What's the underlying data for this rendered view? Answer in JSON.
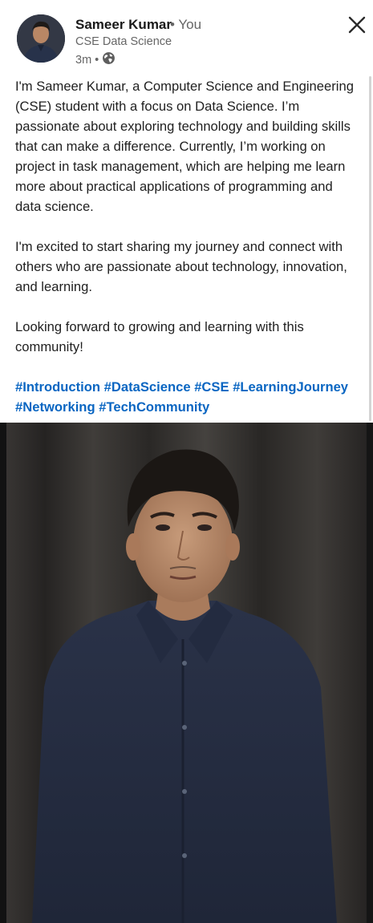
{
  "author": {
    "name": "Sameer Kumar",
    "degree": "• You",
    "headline": "CSE Data Science",
    "time": "3m",
    "separator": "•",
    "visibility_icon": "globe-icon"
  },
  "close_icon": "close-icon",
  "post": {
    "paragraphs": [
      "I'm Sameer Kumar, a Computer Science and Engineering (CSE) student with a focus on Data Science. I’m passionate about exploring technology and building skills that can make a difference. Currently, I’m working on project in task management, which are helping me learn more about practical applications of programming and data science.",
      "I'm excited to start sharing my journey and connect with others who are passionate about technology, innovation, and learning.",
      "Looking forward to growing and learning with this community!"
    ],
    "hashtags": [
      "#Introduction",
      "#DataScience",
      "#CSE",
      "#LearningJourney",
      "#Networking",
      "#TechCommunity"
    ]
  },
  "colors": {
    "hashtag": "#0a66c2",
    "text": "#1f1f1f",
    "muted": "#666666"
  }
}
